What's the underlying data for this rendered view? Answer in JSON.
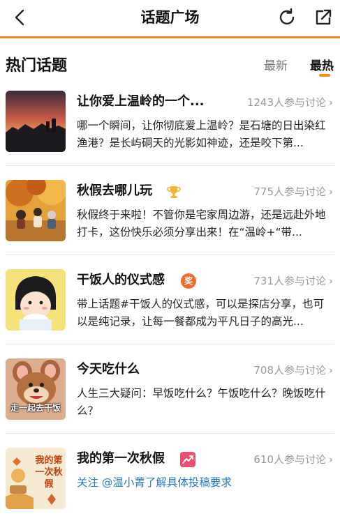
{
  "header": {
    "title": "话题广场"
  },
  "section": {
    "title": "热门话题",
    "tab_new": "最新",
    "tab_hot": "最热"
  },
  "topics": [
    {
      "name": "让你爱上温岭的一个...",
      "count": "1243人参与讨论",
      "desc": "哪一个瞬间，让你彻底爱上温岭？是石塘的日出染红渔港？是长屿硐天的光影如神迹，还是咬下第..."
    },
    {
      "name": "秋假去哪儿玩",
      "count": "775人参与讨论",
      "desc": "秋假终于来啦！不管你是宅家周边游，还是远赴外地打卡，这份快乐必须分享出来！在“温岭+“带...",
      "badge_icon": "trophy-icon"
    },
    {
      "name": "干饭人的仪式感",
      "count": "731人参与讨论",
      "desc": "带上话题#干饭人的仪式感，可以是探店分享，也可以是纯记录，让每一餐都成为平凡日子的高光...",
      "badge_icon": "award-icon",
      "badge_text": "奖"
    },
    {
      "name": "今天吃什么",
      "count": "708人参与讨论",
      "desc": "人生三大疑问：早饭吃什么？午饭吃什么？晚饭吃什么？",
      "thumb_text": "走一起去干饭"
    },
    {
      "name": "我的第一次秋假",
      "count": "610人参与讨论",
      "desc": "关注 @温小菁了解具体投稿要求",
      "badge_icon": "trending-icon",
      "thumb_text": "我的第一次秋假"
    }
  ],
  "colors": {
    "accent": "#f08a24",
    "link": "#2a78c9",
    "muted": "#9a9a9a"
  }
}
